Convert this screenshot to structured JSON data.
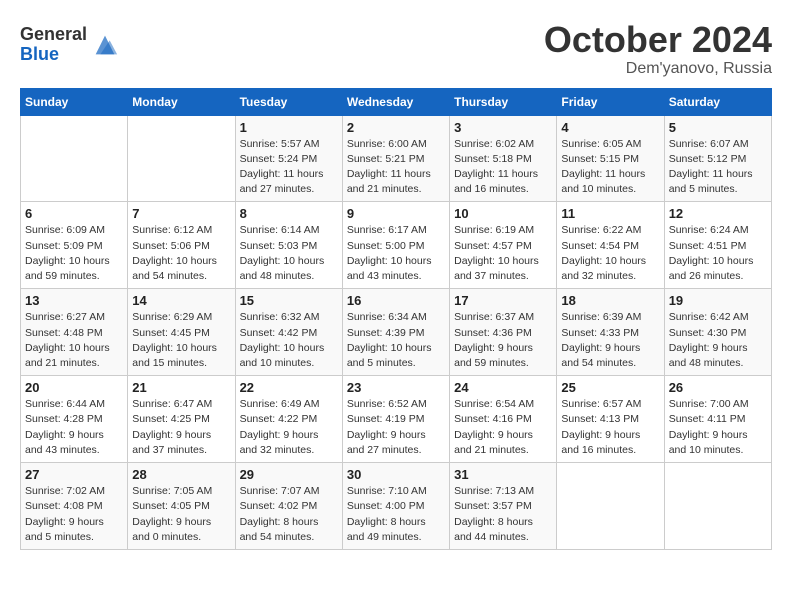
{
  "header": {
    "logo_line1": "General",
    "logo_line2": "Blue",
    "month": "October 2024",
    "location": "Dem'yanovo, Russia"
  },
  "days_of_week": [
    "Sunday",
    "Monday",
    "Tuesday",
    "Wednesday",
    "Thursday",
    "Friday",
    "Saturday"
  ],
  "weeks": [
    [
      {
        "day": "",
        "detail": ""
      },
      {
        "day": "",
        "detail": ""
      },
      {
        "day": "1",
        "detail": "Sunrise: 5:57 AM\nSunset: 5:24 PM\nDaylight: 11 hours and 27 minutes."
      },
      {
        "day": "2",
        "detail": "Sunrise: 6:00 AM\nSunset: 5:21 PM\nDaylight: 11 hours and 21 minutes."
      },
      {
        "day": "3",
        "detail": "Sunrise: 6:02 AM\nSunset: 5:18 PM\nDaylight: 11 hours and 16 minutes."
      },
      {
        "day": "4",
        "detail": "Sunrise: 6:05 AM\nSunset: 5:15 PM\nDaylight: 11 hours and 10 minutes."
      },
      {
        "day": "5",
        "detail": "Sunrise: 6:07 AM\nSunset: 5:12 PM\nDaylight: 11 hours and 5 minutes."
      }
    ],
    [
      {
        "day": "6",
        "detail": "Sunrise: 6:09 AM\nSunset: 5:09 PM\nDaylight: 10 hours and 59 minutes."
      },
      {
        "day": "7",
        "detail": "Sunrise: 6:12 AM\nSunset: 5:06 PM\nDaylight: 10 hours and 54 minutes."
      },
      {
        "day": "8",
        "detail": "Sunrise: 6:14 AM\nSunset: 5:03 PM\nDaylight: 10 hours and 48 minutes."
      },
      {
        "day": "9",
        "detail": "Sunrise: 6:17 AM\nSunset: 5:00 PM\nDaylight: 10 hours and 43 minutes."
      },
      {
        "day": "10",
        "detail": "Sunrise: 6:19 AM\nSunset: 4:57 PM\nDaylight: 10 hours and 37 minutes."
      },
      {
        "day": "11",
        "detail": "Sunrise: 6:22 AM\nSunset: 4:54 PM\nDaylight: 10 hours and 32 minutes."
      },
      {
        "day": "12",
        "detail": "Sunrise: 6:24 AM\nSunset: 4:51 PM\nDaylight: 10 hours and 26 minutes."
      }
    ],
    [
      {
        "day": "13",
        "detail": "Sunrise: 6:27 AM\nSunset: 4:48 PM\nDaylight: 10 hours and 21 minutes."
      },
      {
        "day": "14",
        "detail": "Sunrise: 6:29 AM\nSunset: 4:45 PM\nDaylight: 10 hours and 15 minutes."
      },
      {
        "day": "15",
        "detail": "Sunrise: 6:32 AM\nSunset: 4:42 PM\nDaylight: 10 hours and 10 minutes."
      },
      {
        "day": "16",
        "detail": "Sunrise: 6:34 AM\nSunset: 4:39 PM\nDaylight: 10 hours and 5 minutes."
      },
      {
        "day": "17",
        "detail": "Sunrise: 6:37 AM\nSunset: 4:36 PM\nDaylight: 9 hours and 59 minutes."
      },
      {
        "day": "18",
        "detail": "Sunrise: 6:39 AM\nSunset: 4:33 PM\nDaylight: 9 hours and 54 minutes."
      },
      {
        "day": "19",
        "detail": "Sunrise: 6:42 AM\nSunset: 4:30 PM\nDaylight: 9 hours and 48 minutes."
      }
    ],
    [
      {
        "day": "20",
        "detail": "Sunrise: 6:44 AM\nSunset: 4:28 PM\nDaylight: 9 hours and 43 minutes."
      },
      {
        "day": "21",
        "detail": "Sunrise: 6:47 AM\nSunset: 4:25 PM\nDaylight: 9 hours and 37 minutes."
      },
      {
        "day": "22",
        "detail": "Sunrise: 6:49 AM\nSunset: 4:22 PM\nDaylight: 9 hours and 32 minutes."
      },
      {
        "day": "23",
        "detail": "Sunrise: 6:52 AM\nSunset: 4:19 PM\nDaylight: 9 hours and 27 minutes."
      },
      {
        "day": "24",
        "detail": "Sunrise: 6:54 AM\nSunset: 4:16 PM\nDaylight: 9 hours and 21 minutes."
      },
      {
        "day": "25",
        "detail": "Sunrise: 6:57 AM\nSunset: 4:13 PM\nDaylight: 9 hours and 16 minutes."
      },
      {
        "day": "26",
        "detail": "Sunrise: 7:00 AM\nSunset: 4:11 PM\nDaylight: 9 hours and 10 minutes."
      }
    ],
    [
      {
        "day": "27",
        "detail": "Sunrise: 7:02 AM\nSunset: 4:08 PM\nDaylight: 9 hours and 5 minutes."
      },
      {
        "day": "28",
        "detail": "Sunrise: 7:05 AM\nSunset: 4:05 PM\nDaylight: 9 hours and 0 minutes."
      },
      {
        "day": "29",
        "detail": "Sunrise: 7:07 AM\nSunset: 4:02 PM\nDaylight: 8 hours and 54 minutes."
      },
      {
        "day": "30",
        "detail": "Sunrise: 7:10 AM\nSunset: 4:00 PM\nDaylight: 8 hours and 49 minutes."
      },
      {
        "day": "31",
        "detail": "Sunrise: 7:13 AM\nSunset: 3:57 PM\nDaylight: 8 hours and 44 minutes."
      },
      {
        "day": "",
        "detail": ""
      },
      {
        "day": "",
        "detail": ""
      }
    ]
  ]
}
